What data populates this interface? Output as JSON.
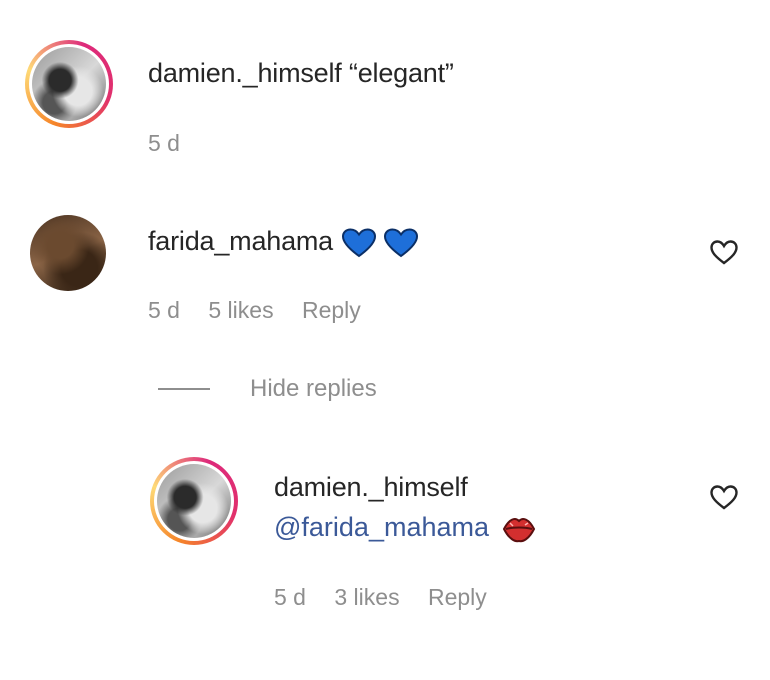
{
  "comments": [
    {
      "username": "damien._himself",
      "text": "“elegant”",
      "time": "5 d"
    },
    {
      "username": "farida_mahama",
      "emojis": [
        "blue-heart-emoji",
        "blue-heart-emoji"
      ],
      "time": "5 d",
      "likes": "5 likes",
      "reply_label": "Reply"
    }
  ],
  "hide_replies_label": "Hide replies",
  "reply": {
    "username": "damien._himself",
    "mention": "@farida_mahama",
    "emoji": "kiss-mark-emoji",
    "time": "5 d",
    "likes": "3 likes",
    "reply_label": "Reply"
  },
  "colors": {
    "username": "#262626",
    "meta": "#8e8e8e",
    "mention": "#3b5998",
    "blue_heart": "#1565c0",
    "kiss": "#c62828"
  },
  "icons": {
    "like": "heart-outline-icon"
  }
}
